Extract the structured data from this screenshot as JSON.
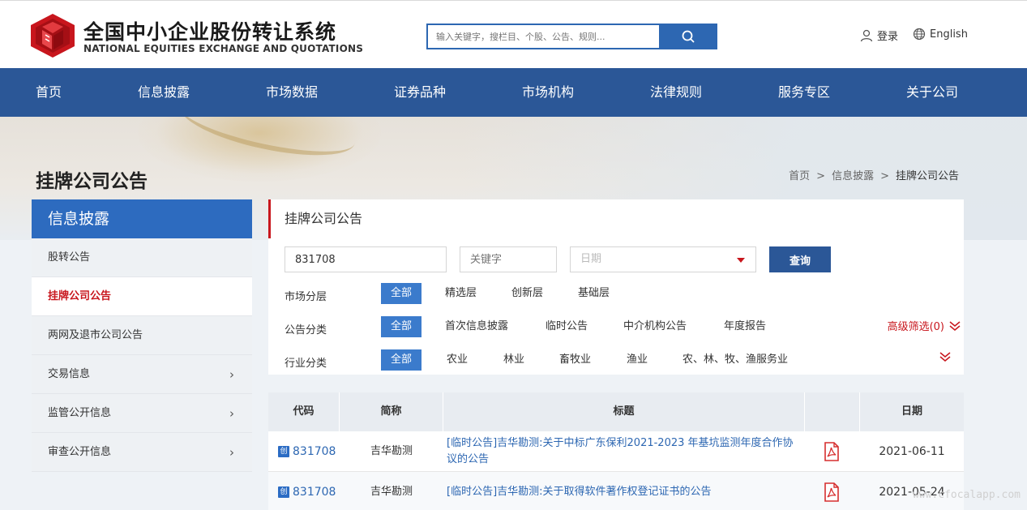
{
  "header": {
    "brand_cn": "全国中小企业股份转让系统",
    "brand_en": "NATIONAL EQUITIES EXCHANGE AND QUOTATIONS",
    "search_placeholder": "输入关键字，搜栏目、个股、公告、规则...",
    "login_label": "登录",
    "english_label": "English",
    "brand_color": "#c8161d"
  },
  "nav": {
    "items": [
      "首页",
      "信息披露",
      "市场数据",
      "证券品种",
      "市场机构",
      "法律规则",
      "服务专区",
      "关于公司"
    ]
  },
  "page": {
    "title": "挂牌公司公告",
    "breadcrumb": [
      "首页",
      "信息披露",
      "挂牌公司公告"
    ],
    "sep": ">"
  },
  "sidebar": {
    "heading": "信息披露",
    "items": [
      {
        "label": "股转公告",
        "active": false,
        "arrow": false
      },
      {
        "label": "挂牌公司公告",
        "active": true,
        "arrow": false
      },
      {
        "label": "两网及退市公司公告",
        "active": false,
        "arrow": false
      },
      {
        "label": "交易信息",
        "active": false,
        "arrow": true
      },
      {
        "label": "监管公开信息",
        "active": false,
        "arrow": true
      },
      {
        "label": "审查公开信息",
        "active": false,
        "arrow": true
      }
    ],
    "arrow_glyph": "›"
  },
  "filters": {
    "panel_title": "挂牌公司公告",
    "code_value": "831708",
    "keyword_placeholder": "关键字",
    "date_placeholder": "日期",
    "query_label": "查询",
    "market_label": "市场分层",
    "market_options": [
      "全部",
      "精选层",
      "创新层",
      "基础层"
    ],
    "announce_label": "公告分类",
    "announce_options": [
      "全部",
      "首次信息披露",
      "临时公告",
      "中介机构公告",
      "年度报告"
    ],
    "industry_label": "行业分类",
    "industry_options": [
      "全部",
      "农业",
      "林业",
      "畜牧业",
      "渔业",
      "农、林、牧、渔服务业"
    ],
    "advanced_label": "高级筛选(0)"
  },
  "table": {
    "headers": {
      "code": "代码",
      "name": "简称",
      "title": "标题",
      "date": "日期"
    },
    "board_badge": "创",
    "rows": [
      {
        "code": "831708",
        "name": "吉华勘测",
        "title": "[临时公告]吉华勘测:关于中标广东保利2021-2023 年基坑监测年度合作协议的公告",
        "date": "2021-06-11"
      },
      {
        "code": "831708",
        "name": "吉华勘测",
        "title": "[临时公告]吉华勘测:关于取得软件著作权登记证书的公告",
        "date": "2021-05-24"
      }
    ]
  },
  "watermark": "www.cfocalapp.com"
}
